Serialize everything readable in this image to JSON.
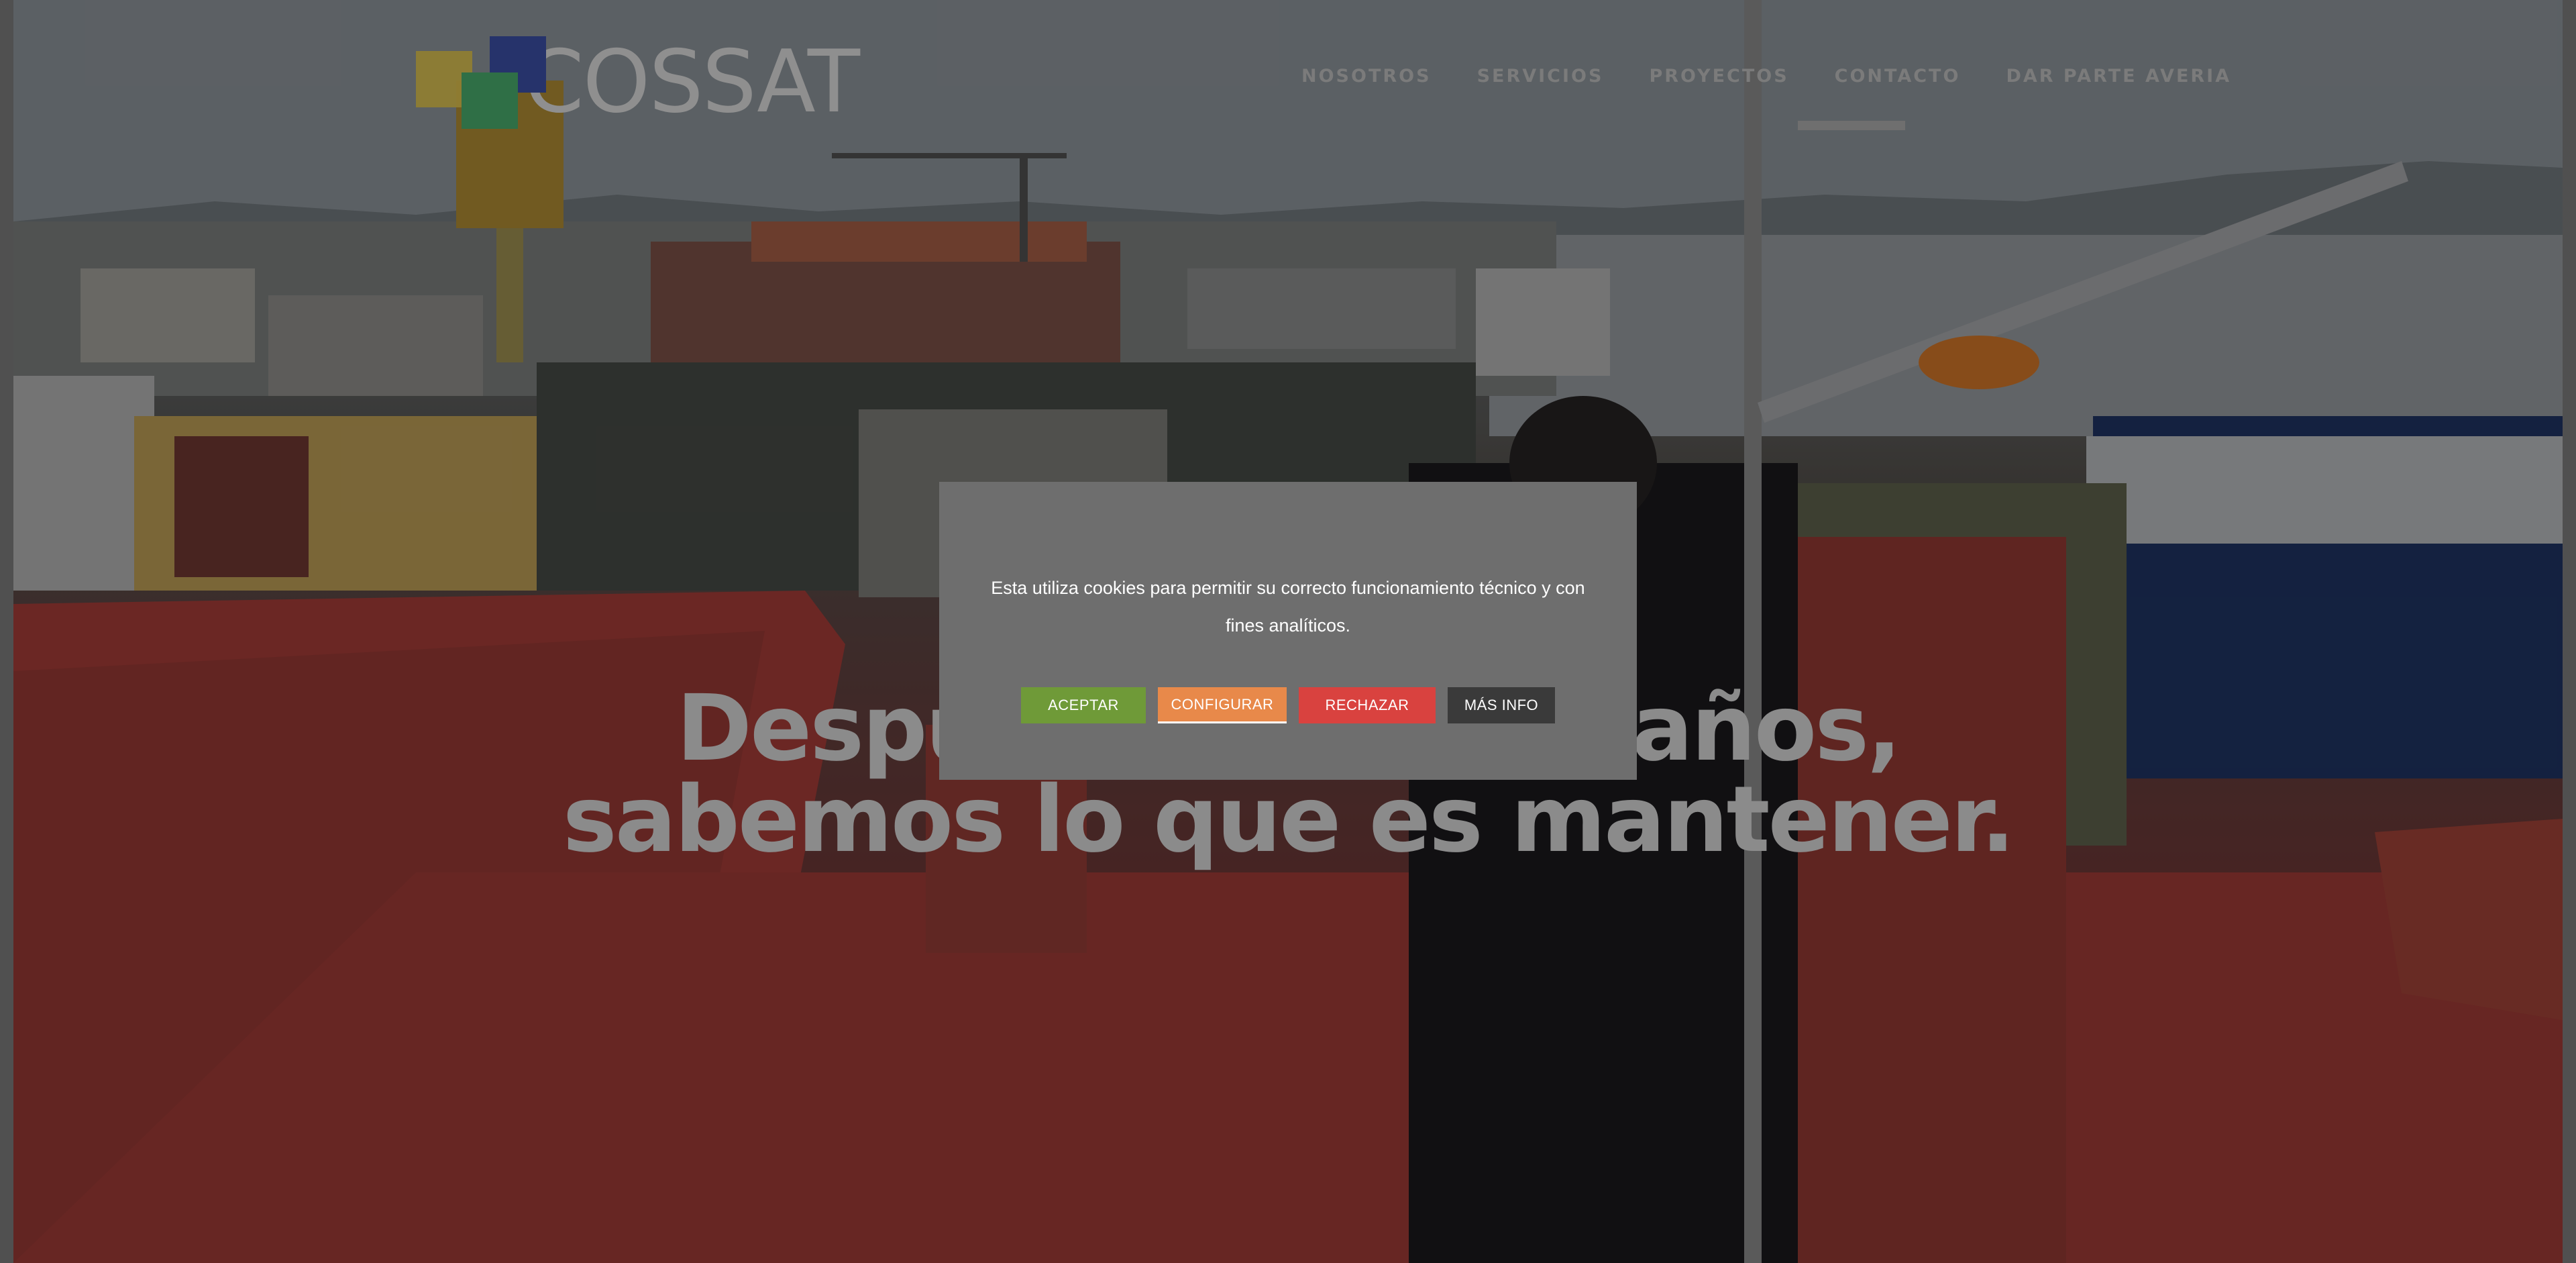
{
  "brand": {
    "name": "COSSAT",
    "logo_colors": [
      "#2b3f86",
      "#bfa23b",
      "#3f9a5b"
    ]
  },
  "nav": {
    "items": [
      {
        "label": "NOSOTROS"
      },
      {
        "label": "SERVICIOS"
      },
      {
        "label": "PROYECTOS"
      },
      {
        "label": "CONTACTO"
      },
      {
        "label": "DAR PARTE AVERIA"
      }
    ]
  },
  "hero": {
    "headline_line1": "Después de tantos años,",
    "headline_line2": "sabemos lo que es mantener."
  },
  "cookie_banner": {
    "message": "Esta utiliza cookies para permitir su correcto funcionamiento técnico y con fines analíticos.",
    "buttons": {
      "accept": {
        "label": "ACEPTAR",
        "color": "#6f9a38"
      },
      "configure": {
        "label": "CONFIGURAR",
        "color": "#e8894a"
      },
      "reject": {
        "label": "RECHAZAR",
        "color": "#d9423f"
      },
      "more_info": {
        "label": "MÁS INFO",
        "color": "#3a3a3a"
      }
    }
  }
}
